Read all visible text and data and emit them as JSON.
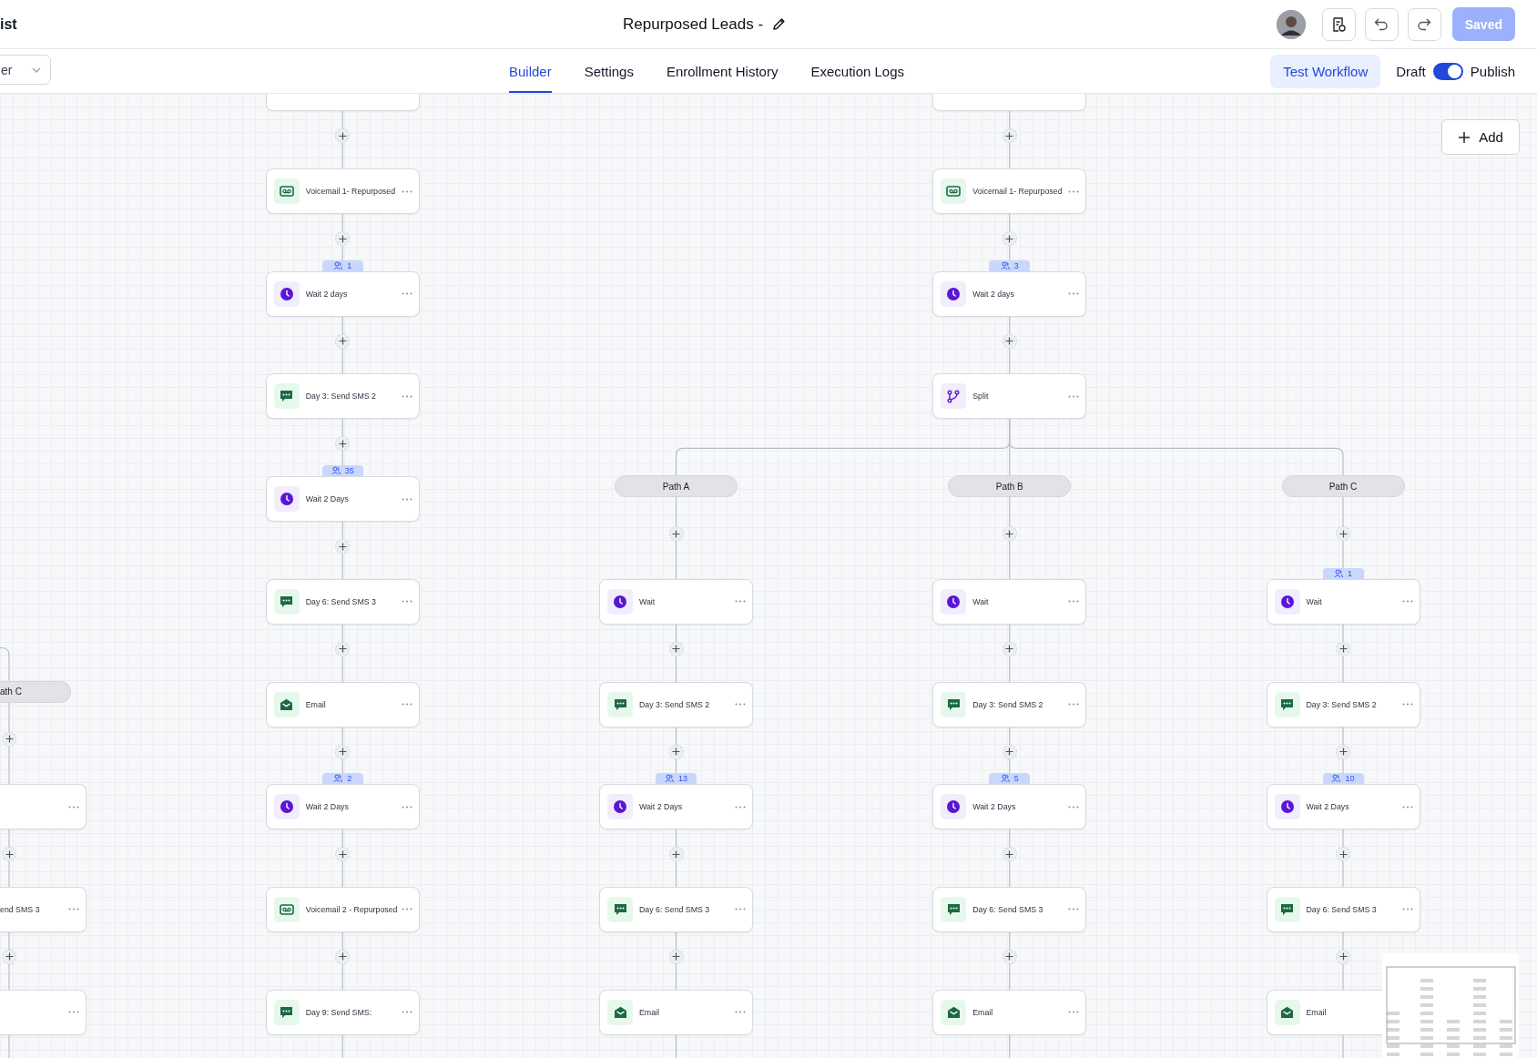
{
  "header": {
    "left_text": "ist",
    "title": "Repurposed Leads -",
    "save_label": "Saved",
    "save_disabled": true
  },
  "toolbar": {
    "dropdown_text": "er",
    "tabs": [
      {
        "label": "Builder",
        "selected": true
      },
      {
        "label": "Settings",
        "selected": false
      },
      {
        "label": "Enrollment History",
        "selected": false
      },
      {
        "label": "Execution Logs",
        "selected": false
      }
    ],
    "test_label": "Test Workflow",
    "draft_label": "Draft",
    "publish_toggle": {
      "on": true
    },
    "publish_label": "Publish"
  },
  "canvas": {
    "add_label": "Add",
    "lanes": [
      {
        "steps": [
          {
            "kind": "path",
            "title": "ath C"
          },
          {
            "kind": "blank"
          },
          {
            "kind": "blank",
            "title": "end SMS 3"
          },
          {
            "kind": "blank"
          }
        ]
      },
      {
        "steps": [
          {
            "kind": "cut"
          },
          {
            "kind": "voicemail",
            "title": "Voicemail 1- Repurposed"
          },
          {
            "kind": "wait",
            "title": "Wait 2 days",
            "count": "1"
          },
          {
            "kind": "sms",
            "title": "Day 3: Send SMS 2"
          },
          {
            "kind": "wait",
            "title": "Wait 2 Days",
            "count": "35"
          },
          {
            "kind": "sms",
            "title": "Day 6: Send SMS 3"
          },
          {
            "kind": "email",
            "title": "Email"
          },
          {
            "kind": "wait",
            "title": "Wait 2 Days",
            "count": "2"
          },
          {
            "kind": "voicemail",
            "title": "Voicemail 2 - Repurposed"
          },
          {
            "kind": "sms",
            "title": "Day 9: Send SMS:"
          }
        ]
      },
      {
        "steps": [
          {
            "kind": "cut"
          },
          {
            "kind": "voicemail",
            "title": "Voicemail 1- Repurposed"
          },
          {
            "kind": "wait",
            "title": "Wait 2 days",
            "count": "3"
          },
          {
            "kind": "split",
            "title": "Split",
            "branches": [
              {
                "steps": [
                  {
                    "kind": "path",
                    "title": "Path A"
                  },
                  {
                    "kind": "wait",
                    "title": "Wait"
                  },
                  {
                    "kind": "sms",
                    "title": "Day 3: Send SMS 2"
                  },
                  {
                    "kind": "wait",
                    "title": "Wait 2 Days",
                    "count": "13"
                  },
                  {
                    "kind": "sms",
                    "title": "Day 6: Send SMS 3"
                  },
                  {
                    "kind": "email",
                    "title": "Email"
                  }
                ]
              },
              {
                "steps": [
                  {
                    "kind": "path",
                    "title": "Path B"
                  },
                  {
                    "kind": "wait",
                    "title": "Wait"
                  },
                  {
                    "kind": "sms",
                    "title": "Day 3: Send SMS 2"
                  },
                  {
                    "kind": "wait",
                    "title": "Wait 2 Days",
                    "count": "5"
                  },
                  {
                    "kind": "sms",
                    "title": "Day 6: Send SMS 3"
                  },
                  {
                    "kind": "email",
                    "title": "Email"
                  }
                ]
              },
              {
                "steps": [
                  {
                    "kind": "path",
                    "title": "Path C"
                  },
                  {
                    "kind": "wait",
                    "title": "Wait",
                    "count": "1"
                  },
                  {
                    "kind": "sms",
                    "title": "Day 3: Send SMS 2"
                  },
                  {
                    "kind": "wait",
                    "title": "Wait 2 Days",
                    "count": "10"
                  },
                  {
                    "kind": "sms",
                    "title": "Day 6: Send SMS 3"
                  },
                  {
                    "kind": "email",
                    "title": "Email"
                  }
                ]
              }
            ]
          }
        ]
      }
    ]
  }
}
